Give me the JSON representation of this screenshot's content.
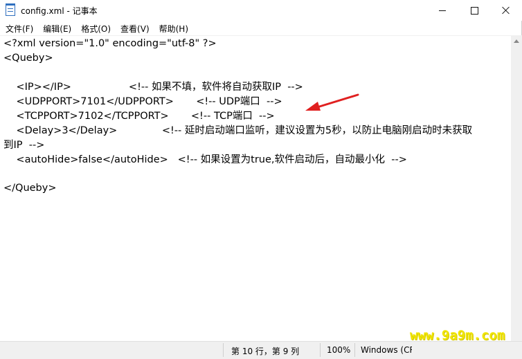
{
  "window": {
    "title": "config.xml - 记事本"
  },
  "menu": {
    "items": [
      "文件(F)",
      "编辑(E)",
      "格式(O)",
      "查看(V)",
      "帮助(H)"
    ]
  },
  "editor": {
    "lines": [
      "<?xml version=\"1.0\" encoding=\"utf-8\" ?>",
      "<Queby>",
      "",
      "    <IP></IP>                  <!-- 如果不填，软件将自动获取IP  -->",
      "    <UDPPORT>7101</UDPPORT>       <!-- UDP端口  -->",
      "    <TCPPORT>7102</TCPPORT>       <!-- TCP端口  -->",
      "    <Delay>3</Delay>              <!-- 延时启动端口监听，建议设置为5秒，以防止电脑刚启动时未获取",
      "到IP  -->",
      "    <autoHide>false</autoHide>   <!-- 如果设置为true,软件启动后，自动最小化  -->",
      "",
      "</Queby>"
    ]
  },
  "status": {
    "position": "第 10 行，第 9 列",
    "zoom": "100%",
    "line_ending": "Windows (CR"
  },
  "watermark": "www.9a9m.com",
  "colors": {
    "arrow": "#e02020",
    "watermark": "#f0e600"
  }
}
